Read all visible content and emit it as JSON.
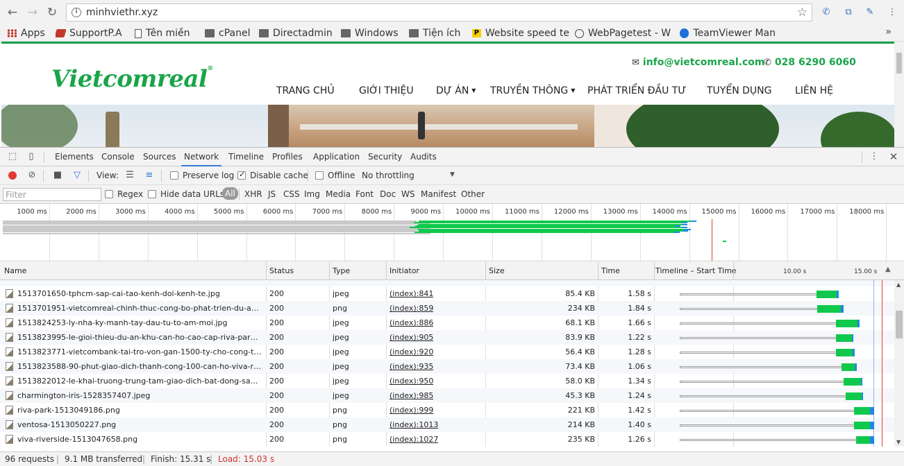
{
  "browser": {
    "url": "minhviethr.xyz",
    "bookmarks": [
      {
        "label": "Apps",
        "icon": "apps-grid-icon"
      },
      {
        "label": "SupportP.A",
        "icon": "bookmark-favicon"
      },
      {
        "label": "Tên miền",
        "icon": "page-icon"
      },
      {
        "label": "cPanel",
        "icon": "folder-icon"
      },
      {
        "label": "Directadmin",
        "icon": "folder-icon"
      },
      {
        "label": "Windows",
        "icon": "folder-icon"
      },
      {
        "label": "Tiện ích",
        "icon": "folder-icon"
      },
      {
        "label": "Website speed te",
        "icon": "p-favicon"
      },
      {
        "label": "WebPagetest - W",
        "icon": "gauge-favicon"
      },
      {
        "label": "TeamViewer Man",
        "icon": "teamviewer-favicon"
      }
    ],
    "more": "»"
  },
  "site": {
    "logo": "Vietcomreal",
    "email": "info@vietcomreal.com",
    "phone": "028 6290 6060",
    "menu": [
      {
        "label": "TRANG CHỦ",
        "caret": false
      },
      {
        "label": "GIỚI THIỆU",
        "caret": false
      },
      {
        "label": "DỰ ÁN",
        "caret": true
      },
      {
        "label": "TRUYỀN THÔNG",
        "caret": true
      },
      {
        "label": "PHÁT TRIỂN ĐẦU TƯ",
        "caret": false
      },
      {
        "label": "TUYỂN DỤNG",
        "caret": false
      },
      {
        "label": "LIÊN HỆ",
        "caret": false
      }
    ],
    "colors": {
      "brand": "#1aa549"
    }
  },
  "devtools": {
    "tabs": [
      "Elements",
      "Console",
      "Sources",
      "Network",
      "Timeline",
      "Profiles",
      "Application",
      "Security",
      "Audits"
    ],
    "active_tab": "Network",
    "toolbar": {
      "view_label": "View:",
      "preserve_log": "Preserve log",
      "preserve_log_checked": false,
      "disable_cache": "Disable cache",
      "disable_cache_checked": true,
      "offline": "Offline",
      "offline_checked": false,
      "throttling": "No throttling"
    },
    "filter": {
      "placeholder": "Filter",
      "regex": "Regex",
      "hide_data_urls": "Hide data URLs",
      "types": [
        "All",
        "XHR",
        "JS",
        "CSS",
        "Img",
        "Media",
        "Font",
        "Doc",
        "WS",
        "Manifest",
        "Other"
      ],
      "active_type": "All"
    },
    "overview_ticks": [
      "1000 ms",
      "2000 ms",
      "3000 ms",
      "4000 ms",
      "5000 ms",
      "6000 ms",
      "7000 ms",
      "8000 ms",
      "9000 ms",
      "10000 ms",
      "11000 ms",
      "12000 ms",
      "13000 ms",
      "14000 ms",
      "15000 ms",
      "16000 ms",
      "17000 ms",
      "18000 ms"
    ],
    "columns": [
      "Name",
      "Status",
      "Type",
      "Initiator",
      "Size",
      "Time",
      "Timeline – Start Time"
    ],
    "timeline_ticks": [
      "10.00 s",
      "15.00 s"
    ],
    "rows": [
      {
        "name": "1513701650-tphcm-sap-cai-tao-kenh-doi-kenh-te.jpg",
        "status": "200",
        "type": "jpeg",
        "initiator": "(index):841",
        "size": "85.4 KB",
        "time": "1.58 s",
        "start_s": 9.93,
        "wait_s": 1.42,
        "dl_s": 0.16
      },
      {
        "name": "1513701951-vietcomreal-chinh-thuc-cong-bo-phat-trien-du-an-moi-k...",
        "status": "200",
        "type": "png",
        "initiator": "(index):859",
        "size": "234 KB",
        "time": "1.84 s",
        "start_s": 10.0,
        "wait_s": 1.64,
        "dl_s": 0.2
      },
      {
        "name": "1513824253-ly-nha-ky-manh-tay-dau-tu-to-am-moi.jpg",
        "status": "200",
        "type": "jpeg",
        "initiator": "(index):886",
        "size": "68.1 KB",
        "time": "1.66 s",
        "start_s": 11.31,
        "wait_s": 1.5,
        "dl_s": 0.16
      },
      {
        "name": "1513823995-le-gioi-thieu-du-an-khu-can-ho-cao-cap-riva-park.JPG",
        "status": "200",
        "type": "jpeg",
        "initiator": "(index):905",
        "size": "83.9 KB",
        "time": "1.22 s",
        "start_s": 11.31,
        "wait_s": 1.1,
        "dl_s": 0.12
      },
      {
        "name": "1513823771-vietcombank-tai-tro-von-gan-1500-ty-cho-cong-ty-vietc...",
        "status": "200",
        "type": "jpeg",
        "initiator": "(index):920",
        "size": "56.4 KB",
        "time": "1.28 s",
        "start_s": 11.31,
        "wait_s": 1.18,
        "dl_s": 0.1
      },
      {
        "name": "1513823588-90-phut-giao-dich-thanh-cong-100-can-ho-viva-riverside...",
        "status": "200",
        "type": "jpeg",
        "initiator": "(index):935",
        "size": "73.4 KB",
        "time": "1.06 s",
        "start_s": 11.71,
        "wait_s": 0.9,
        "dl_s": 0.16
      },
      {
        "name": "1513822012-le-khai-truong-trung-tam-giao-dich-bat-dong-san-vietco...",
        "status": "200",
        "type": "jpeg",
        "initiator": "(index):950",
        "size": "58.0 KB",
        "time": "1.34 s",
        "start_s": 11.81,
        "wait_s": 1.24,
        "dl_s": 0.1
      },
      {
        "name": "charmington-iris-1528357407.jpeg",
        "status": "200",
        "type": "jpeg",
        "initiator": "(index):985",
        "size": "45.3 KB",
        "time": "1.24 s",
        "start_s": 11.96,
        "wait_s": 1.14,
        "dl_s": 0.1
      },
      {
        "name": "riva-park-1513049186.png",
        "status": "200",
        "type": "png",
        "initiator": "(index):999",
        "size": "221 KB",
        "time": "1.42 s",
        "start_s": 12.56,
        "wait_s": 1.12,
        "dl_s": 0.3
      },
      {
        "name": "ventosa-1513050227.png",
        "status": "200",
        "type": "png",
        "initiator": "(index):1013",
        "size": "214 KB",
        "time": "1.40 s",
        "start_s": 12.56,
        "wait_s": 1.12,
        "dl_s": 0.28
      },
      {
        "name": "viva-riverside-1513047658.png",
        "status": "200",
        "type": "png",
        "initiator": "(index):1027",
        "size": "235 KB",
        "time": "1.26 s",
        "start_s": 12.71,
        "wait_s": 0.98,
        "dl_s": 0.28
      }
    ],
    "status": {
      "requests": "96 requests",
      "transferred": "9.1 MB transferred",
      "finish": "Finish: 15.31 s",
      "load": "Load: 15.03 s"
    },
    "colors": {
      "waiting": "#10c94c",
      "download": "#1e88e5",
      "load_line": "#e53935",
      "active_tab": "#3879d9"
    }
  }
}
